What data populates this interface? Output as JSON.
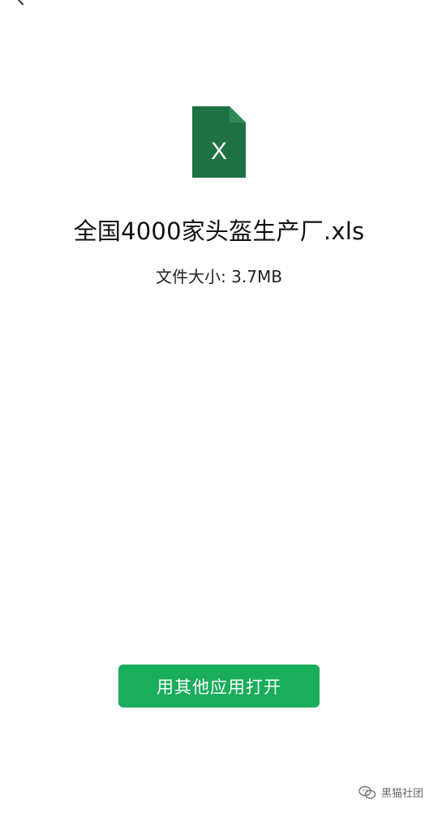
{
  "file": {
    "icon": "excel-file-icon",
    "icon_letter": "X",
    "name": "全国4000家头盔生产厂.xls",
    "size_label": "文件大小: 3.7MB"
  },
  "actions": {
    "open_with_other_app": "用其他应用打开"
  },
  "watermark": {
    "icon": "wechat-icon",
    "text": "黑猫社团"
  },
  "colors": {
    "primary_button": "#1aad5b",
    "excel_dark_green": "#1e7145",
    "excel_fold": "#2e8b57"
  }
}
